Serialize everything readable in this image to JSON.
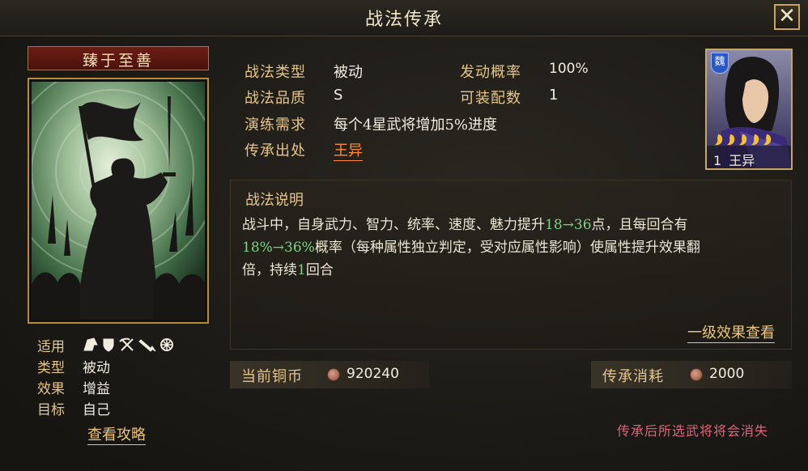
{
  "header": {
    "title": "战法传承",
    "close_glyph": "✕"
  },
  "card": {
    "name": "臻于至善",
    "applicable_label": "适用",
    "applicable_icons": [
      "cavalry-icon",
      "shield-icon",
      "bow-icon",
      "spear-icon",
      "wheel-icon"
    ],
    "type_label": "类型",
    "type_value": "被动",
    "effect_label": "效果",
    "effect_value": "增益",
    "target_label": "目标",
    "target_value": "自己",
    "guide_link": "查看攻略"
  },
  "info": {
    "tactic_type_label": "战法类型",
    "tactic_type_value": "被动",
    "trigger_rate_label": "发动概率",
    "trigger_rate_value": "100%",
    "quality_label": "战法品质",
    "quality_value": "S",
    "equip_count_label": "可装配数",
    "equip_count_value": "1",
    "training_label": "演练需求",
    "training_value": "每个4星武将增加5%进度",
    "source_label": "传承出处",
    "source_value": "王异"
  },
  "general": {
    "faction": "魏",
    "stars": 5,
    "level": "1",
    "name": "王异"
  },
  "description": {
    "title": "战法说明",
    "line1_a": "战斗中，自身武力、智力、统率、速度、魅力提升",
    "line1_g": "18→36",
    "line1_b": "点，且每回合有",
    "line2_g": "18%→36%",
    "line2_b": "概率（每种属性独立判定，受对应属性影响）使属性提升效果翻",
    "line3_a": "倍，持续",
    "line3_g": "1",
    "line3_b": "回合",
    "effect_link": "一级效果查看"
  },
  "costs": {
    "copper_label": "当前铜币",
    "copper_value": "920240",
    "inherit_label": "传承消耗",
    "inherit_value": "2000"
  },
  "warning": "传承后所选武将将会消失",
  "colors": {
    "accent_gold": "#e6c58a",
    "highlight_green": "#7fd08a",
    "link_orange": "#ff8a3a",
    "warning_red": "#e0647a"
  }
}
